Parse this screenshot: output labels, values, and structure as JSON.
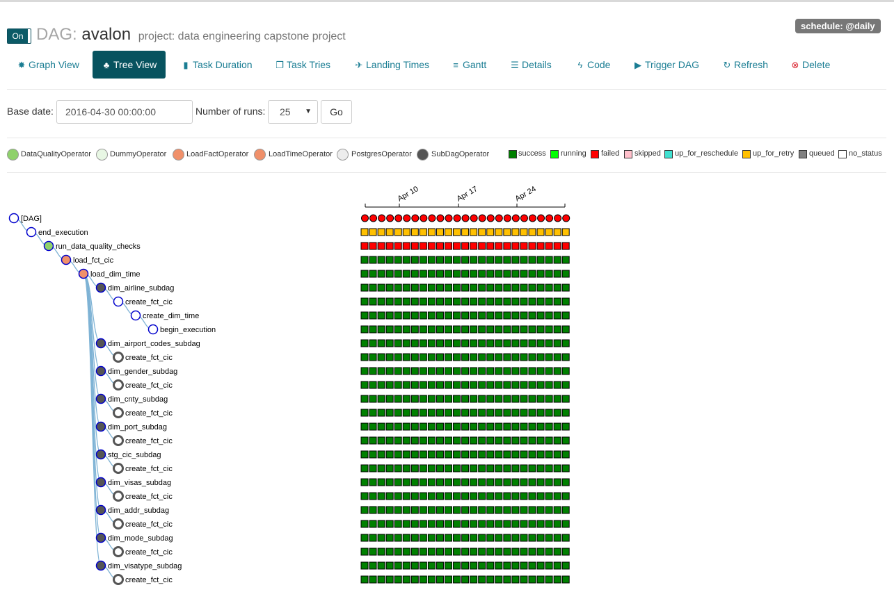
{
  "header": {
    "toggle_label": "On",
    "dag_prefix": "DAG:",
    "dag_name": "avalon",
    "project": "project: data engineering capstone project",
    "schedule": "schedule: @daily"
  },
  "nav": [
    {
      "label": "Graph View",
      "icon": "asterisk-icon",
      "glyph": "✸",
      "active": false
    },
    {
      "label": "Tree View",
      "icon": "tree-icon",
      "glyph": "♣",
      "active": true
    },
    {
      "label": "Task Duration",
      "icon": "bar-chart-icon",
      "glyph": "▮",
      "active": false
    },
    {
      "label": "Task Tries",
      "icon": "duplicate-icon",
      "glyph": "❐",
      "active": false
    },
    {
      "label": "Landing Times",
      "icon": "plane-icon",
      "glyph": "✈",
      "active": false
    },
    {
      "label": "Gantt",
      "icon": "align-left-icon",
      "glyph": "≡",
      "active": false
    },
    {
      "label": "Details",
      "icon": "list-icon",
      "glyph": "☰",
      "active": false
    },
    {
      "label": "Code",
      "icon": "flash-icon",
      "glyph": "ϟ",
      "active": false
    },
    {
      "label": "Trigger DAG",
      "icon": "play-circle-icon",
      "glyph": "▶",
      "active": false
    },
    {
      "label": "Refresh",
      "icon": "refresh-icon",
      "glyph": "↻",
      "active": false
    },
    {
      "label": "Delete",
      "icon": "remove-circle-icon",
      "glyph": "⊗",
      "active": false
    }
  ],
  "form": {
    "base_date_label": "Base date:",
    "base_date_value": "2016-04-30 00:00:00",
    "num_runs_label": "Number of runs:",
    "num_runs_value": "25",
    "go_label": "Go"
  },
  "operators": [
    {
      "name": "DataQualityOperator",
      "color": "#8fd16b"
    },
    {
      "name": "DummyOperator",
      "color": "#e8f7e4"
    },
    {
      "name": "LoadFactOperator",
      "color": "#f0906a"
    },
    {
      "name": "LoadTimeOperator",
      "color": "#f0906a"
    },
    {
      "name": "PostgresOperator",
      "color": "#ededed"
    },
    {
      "name": "SubDagOperator",
      "color": "#555555"
    }
  ],
  "states": [
    {
      "name": "success",
      "color": "#008000"
    },
    {
      "name": "running",
      "color": "#00ff00"
    },
    {
      "name": "failed",
      "color": "#ff0000"
    },
    {
      "name": "skipped",
      "color": "#ffc0cb"
    },
    {
      "name": "up_for_reschedule",
      "color": "#40e0d0"
    },
    {
      "name": "up_for_retry",
      "color": "#ffc000"
    },
    {
      "name": "queued",
      "color": "#808080"
    },
    {
      "name": "no_status",
      "color": "#ffffff"
    }
  ],
  "axis_ticks": [
    "Apr 10",
    "Apr 17",
    "Apr 24"
  ],
  "tree": [
    {
      "label": "[DAG]",
      "depth": 0,
      "node": "dag",
      "fill": "#ffffff",
      "stroke": "#0000cc",
      "status": "failed"
    },
    {
      "label": "end_execution",
      "depth": 1,
      "node": "task",
      "fill": "#ffffff",
      "stroke": "#0000cc",
      "status": "up_for_retry"
    },
    {
      "label": "run_data_quality_checks",
      "depth": 2,
      "node": "task",
      "fill": "#8fd16b",
      "stroke": "#0000cc",
      "status": "failed"
    },
    {
      "label": "load_fct_cic",
      "depth": 3,
      "node": "task",
      "fill": "#f0906a",
      "stroke": "#0000cc",
      "status": "success"
    },
    {
      "label": "load_dim_time",
      "depth": 4,
      "node": "task",
      "fill": "#f0906a",
      "stroke": "#0000cc",
      "status": "success"
    },
    {
      "label": "dim_airline_subdag",
      "depth": 5,
      "node": "task",
      "fill": "#555555",
      "stroke": "#0000cc",
      "status": "success"
    },
    {
      "label": "create_fct_cic",
      "depth": 6,
      "node": "task",
      "fill": "#ffffff",
      "stroke": "#0000cc",
      "status": "success"
    },
    {
      "label": "create_dim_time",
      "depth": 7,
      "node": "task",
      "fill": "#ffffff",
      "stroke": "#0000cc",
      "status": "success"
    },
    {
      "label": "begin_execution",
      "depth": 8,
      "node": "task",
      "fill": "#ffffff",
      "stroke": "#0000cc",
      "status": "success"
    },
    {
      "label": "dim_airport_codes_subdag",
      "depth": 5,
      "node": "task",
      "fill": "#555555",
      "stroke": "#0000cc",
      "status": "success"
    },
    {
      "label": "create_fct_cic",
      "depth": 6,
      "node": "ref",
      "fill": "#ffffff",
      "stroke": "#555555",
      "status": "success"
    },
    {
      "label": "dim_gender_subdag",
      "depth": 5,
      "node": "task",
      "fill": "#555555",
      "stroke": "#0000cc",
      "status": "success"
    },
    {
      "label": "create_fct_cic",
      "depth": 6,
      "node": "ref",
      "fill": "#ffffff",
      "stroke": "#555555",
      "status": "success"
    },
    {
      "label": "dim_cnty_subdag",
      "depth": 5,
      "node": "task",
      "fill": "#555555",
      "stroke": "#0000cc",
      "status": "success"
    },
    {
      "label": "create_fct_cic",
      "depth": 6,
      "node": "ref",
      "fill": "#ffffff",
      "stroke": "#555555",
      "status": "success"
    },
    {
      "label": "dim_port_subdag",
      "depth": 5,
      "node": "task",
      "fill": "#555555",
      "stroke": "#0000cc",
      "status": "success"
    },
    {
      "label": "create_fct_cic",
      "depth": 6,
      "node": "ref",
      "fill": "#ffffff",
      "stroke": "#555555",
      "status": "success"
    },
    {
      "label": "stg_cic_subdag",
      "depth": 5,
      "node": "task",
      "fill": "#555555",
      "stroke": "#0000cc",
      "status": "success"
    },
    {
      "label": "create_fct_cic",
      "depth": 6,
      "node": "ref",
      "fill": "#ffffff",
      "stroke": "#555555",
      "status": "success"
    },
    {
      "label": "dim_visas_subdag",
      "depth": 5,
      "node": "task",
      "fill": "#555555",
      "stroke": "#0000cc",
      "status": "success"
    },
    {
      "label": "create_fct_cic",
      "depth": 6,
      "node": "ref",
      "fill": "#ffffff",
      "stroke": "#555555",
      "status": "success"
    },
    {
      "label": "dim_addr_subdag",
      "depth": 5,
      "node": "task",
      "fill": "#555555",
      "stroke": "#0000cc",
      "status": "success"
    },
    {
      "label": "create_fct_cic",
      "depth": 6,
      "node": "ref",
      "fill": "#ffffff",
      "stroke": "#555555",
      "status": "success"
    },
    {
      "label": "dim_mode_subdag",
      "depth": 5,
      "node": "task",
      "fill": "#555555",
      "stroke": "#0000cc",
      "status": "success"
    },
    {
      "label": "create_fct_cic",
      "depth": 6,
      "node": "ref",
      "fill": "#ffffff",
      "stroke": "#555555",
      "status": "success"
    },
    {
      "label": "dim_visatype_subdag",
      "depth": 5,
      "node": "task",
      "fill": "#555555",
      "stroke": "#0000cc",
      "status": "success"
    },
    {
      "label": "create_fct_cic",
      "depth": 6,
      "node": "ref",
      "fill": "#ffffff",
      "stroke": "#555555",
      "status": "success"
    }
  ],
  "run_count": 25,
  "link_color": "#7fb3d5"
}
